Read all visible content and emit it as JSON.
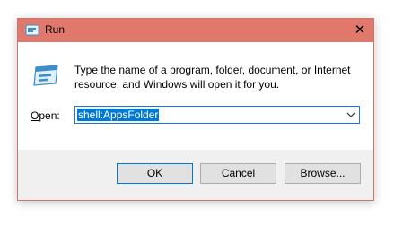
{
  "window": {
    "title": "Run",
    "close_glyph": "✕",
    "app_icon": "run-app-icon",
    "title_color": "#e0786b"
  },
  "content": {
    "icon": "run-dialog-icon",
    "description": "Type the name of a program, folder, document, or Internet resource, and Windows will open it for you.",
    "open_label_mnemonic": "O",
    "open_label_rest": "pen:",
    "open_value": "shell:AppsFolder",
    "selection_color": "#0078d7"
  },
  "buttons": {
    "ok": "OK",
    "cancel": "Cancel",
    "browse_mnemonic": "B",
    "browse_rest": "rowse..."
  }
}
